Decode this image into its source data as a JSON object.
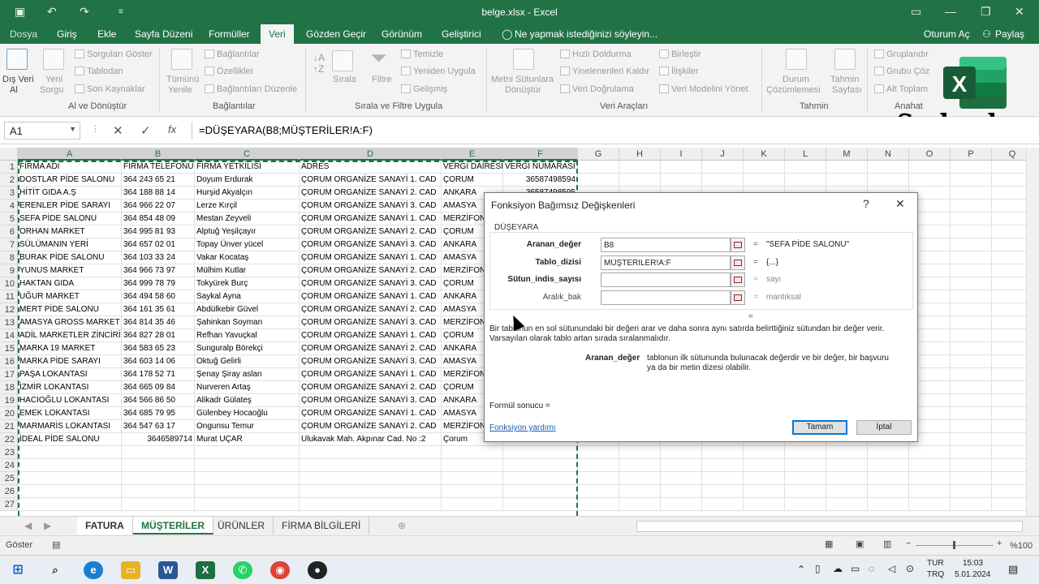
{
  "window": {
    "title": "belge.xlsx - Excel"
  },
  "ribbon_tabs": [
    "Dosya",
    "Giriş",
    "Ekle",
    "Sayfa Düzeni",
    "Formüller",
    "Veri",
    "Gözden Geçir",
    "Görünüm",
    "Geliştirici"
  ],
  "active_tab": "Veri",
  "tell_me": "Ne yapmak istediğinizi söyleyin...",
  "signin": "Oturum Aç",
  "share": "Paylaş",
  "ribbon": {
    "get_external": [
      "Dış Veri",
      "Al"
    ],
    "new_query": [
      "Yeni",
      "Sorgu"
    ],
    "queries": [
      "Sorguları Göster",
      "Tablodan",
      "Son Kaynaklar"
    ],
    "group1": "Al ve Dönüştür",
    "refresh_all": [
      "Tümünü",
      "Yenile"
    ],
    "connections": [
      "Bağlantılar",
      "Özellikler",
      "Bağlantıları Düzenle"
    ],
    "group2": "Bağlantılar",
    "sort": "Sırala",
    "filter": "Filtre",
    "filter_items": [
      "Temizle",
      "Yeniden Uygula",
      "Gelişmiş"
    ],
    "group3": "Sırala ve Filtre Uygula",
    "text_to_columns": [
      "Metni Sütunlara",
      "Dönüştür"
    ],
    "tools1": [
      "Hızlı Doldurma",
      "Yinelenenleri Kaldır",
      "Veri Doğrulama"
    ],
    "tools2": [
      "Birleştir",
      "İlişkiler",
      "Veri Modelini Yönet"
    ],
    "group4": "Veri Araçları",
    "what_if": [
      "Durum",
      "Çözümlemesi"
    ],
    "forecast": [
      "Tahmin",
      "Sayfası"
    ],
    "group5": "Tahmin",
    "outline": [
      "Gruplandır",
      "Grubu Çöz",
      "Alt Toplam"
    ],
    "group6": "Anahat"
  },
  "watermark": "Serkanhoca19",
  "namebox": "A1",
  "formula_icons": {
    "cancel": "✕",
    "enter": "✓",
    "fx": "fx"
  },
  "formula": "=DÜŞEYARA(B8;MÜŞTERİLER!A:F)",
  "columns": [
    "A",
    "B",
    "C",
    "D",
    "E",
    "F",
    "G",
    "H",
    "I",
    "J",
    "K",
    "L",
    "M",
    "N",
    "O",
    "P",
    "Q"
  ],
  "rows": [
    [
      "FİRMA ADI",
      "FİRMA TELEFONU",
      "FİRMA YETKİLİSİ",
      "ADRES",
      "VERGİ DAİRESİ",
      "VERGİ NUMARASI"
    ],
    [
      "DOSTLAR PİDE SALONU",
      "364 243 65 21",
      "Doyum Erdurak",
      "ÇORUM ORGANİZE SANAYİ 1. CAD",
      "ÇORUM",
      "36587498594"
    ],
    [
      "HİTİT GIDA A.Ş",
      "364 188 88 14",
      "Hurşid Akyalçın",
      "ÇORUM ORGANİZE SANAYİ 2. CAD",
      "ANKARA",
      "36587498595"
    ],
    [
      "ERENLER PİDE SARAYI",
      "364 966 22 07",
      "Lerze Kırçil",
      "ÇORUM ORGANİZE SANAYİ 3. CAD",
      "AMASYA",
      ""
    ],
    [
      "SEFA PİDE SALONU",
      "364 854 48 09",
      "Mestan Zeyveli",
      "ÇORUM ORGANİZE SANAYİ 1. CAD",
      "MERZİFON",
      ""
    ],
    [
      "ORHAN MARKET",
      "364 995 81 93",
      "Alptuğ Yeşilçayır",
      "ÇORUM ORGANİZE SANAYİ 2. CAD",
      "ÇORUM",
      ""
    ],
    [
      "SÜLÜMANIN YERİ",
      "364 657 02 01",
      "Topay Ünver yücel",
      "ÇORUM ORGANİZE SANAYİ 3. CAD",
      "ANKARA",
      ""
    ],
    [
      "BURAK PİDE SALONU",
      "364 103 33 24",
      "Vakar Kocataş",
      "ÇORUM ORGANİZE SANAYİ 1. CAD",
      "AMASYA",
      ""
    ],
    [
      "YUNUS MARKET",
      "364 966 73 97",
      "Mülhim Kutlar",
      "ÇORUM ORGANİZE SANAYİ 2. CAD",
      "MERZİFON",
      ""
    ],
    [
      "HAKTAN GIDA",
      "364 999 78 79",
      "Tokyürek Burç",
      "ÇORUM ORGANİZE SANAYİ 3. CAD",
      "ÇORUM",
      ""
    ],
    [
      "UĞUR MARKET",
      "364 494 58 60",
      "Saykal Ayna",
      "ÇORUM ORGANİZE SANAYİ 1. CAD",
      "ANKARA",
      ""
    ],
    [
      "MERT PİDE SALONU",
      "364 161 35 61",
      "Abdülkebir Güvel",
      "ÇORUM ORGANİZE SANAYİ 2. CAD",
      "AMASYA",
      ""
    ],
    [
      "AMASYA GROSS MARKET",
      "364 814 35 46",
      "Şahinkan Soyman",
      "ÇORUM ORGANİZE SANAYİ 3. CAD",
      "MERZİFON",
      ""
    ],
    [
      "ADİL MARKETLER ZİNCİRİ",
      "364 827 28 01",
      "Refhan Yavuçkal",
      "ÇORUM ORGANİZE SANAYİ 1. CAD",
      "ÇORUM",
      ""
    ],
    [
      "MARKA 19 MARKET",
      "364 583 65 23",
      "Sunguralp Börekçi",
      "ÇORUM ORGANİZE SANAYİ 2. CAD",
      "ANKARA",
      ""
    ],
    [
      "MARKA PİDE SARAYI",
      "364 603 14 06",
      "Oktuğ Gelirli",
      "ÇORUM ORGANİZE SANAYİ 3. CAD",
      "AMASYA",
      ""
    ],
    [
      "PAŞA LOKANTASI",
      "364 178 52 71",
      "Şenay Şiray aslan",
      "ÇORUM ORGANİZE SANAYİ 1. CAD",
      "MERZİFON",
      ""
    ],
    [
      "İZMİR LOKANTASI",
      "364 665 09 84",
      "Nurveren Artaş",
      "ÇORUM ORGANİZE SANAYİ 2. CAD",
      "ÇORUM",
      ""
    ],
    [
      "HACIOĞLU LOKANTASI",
      "364 566 86 50",
      "Alikadr Gülateş",
      "ÇORUM ORGANİZE SANAYİ 3. CAD",
      "ANKARA",
      ""
    ],
    [
      "EMEK LOKANTASI",
      "364 685 79 95",
      "Gülenbey Hocaoğlu",
      "ÇORUM ORGANİZE SANAYİ 1. CAD",
      "AMASYA",
      ""
    ],
    [
      "MARMARİS LOKANTASI",
      "364 547 63 17",
      "Ongunsu Temur",
      "ÇORUM ORGANİZE SANAYİ 2. CAD",
      "MERZİFON",
      ""
    ],
    [
      "İDEAL PİDE SALONU",
      "3646589714",
      "Murat UÇAR",
      "Ulukavak Mah. Akpınar Cad. No :2",
      "Çorum",
      ""
    ]
  ],
  "row_numbers": [
    "1",
    "2",
    "3",
    "4",
    "5",
    "6",
    "7",
    "8",
    "9",
    "10",
    "11",
    "12",
    "13",
    "14",
    "15",
    "16",
    "17",
    "18",
    "19",
    "20",
    "21",
    "22",
    "23",
    "24",
    "25",
    "26",
    "27"
  ],
  "sheets": [
    "FATURA",
    "MÜŞTERİLER",
    "ÜRÜNLER",
    "FİRMA BİLGİLERİ"
  ],
  "active_sheet": "MÜŞTERİLER",
  "status": {
    "mode": "Göster",
    "zoom": "%100"
  },
  "taskbar": {
    "lang1": "TUR",
    "lang2": "TRQ",
    "time": "15:03",
    "date": "5.01.2024"
  },
  "dialog": {
    "title": "Fonksiyon Bağımsız Değişkenleri",
    "help": "?",
    "close": "✕",
    "function": "DÜŞEYARA",
    "args": [
      {
        "label": "Aranan_değer",
        "value": "B8",
        "result": "\"SEFA PİDE SALONU\""
      },
      {
        "label": "Tablo_dizisi",
        "value": "MÜŞTERİLER!A:F",
        "result": "{...}"
      },
      {
        "label": "Sütun_indis_sayısı",
        "value": "",
        "result": "sayı"
      },
      {
        "label": "Aralık_bak",
        "value": "",
        "result": "mantıksal"
      }
    ],
    "eq": "=",
    "description": "Bir tablonun en sol sütunundaki bir değeri arar ve daha sonra aynı satırda belirttiğiniz sütundan bir değer verir. Varsayılan olarak tablo artan sırada sıralanmalıdır.",
    "arg_name": "Aranan_değer",
    "arg_desc": "tablonun ilk sütununda bulunacak değerdir ve bir değer, bir başvuru ya da bir metin dizesi olabilir.",
    "result_label": "Formül sonucu =",
    "help_link": "Fonksiyon yardımı",
    "ok": "Tamam",
    "cancel": "İptal"
  }
}
